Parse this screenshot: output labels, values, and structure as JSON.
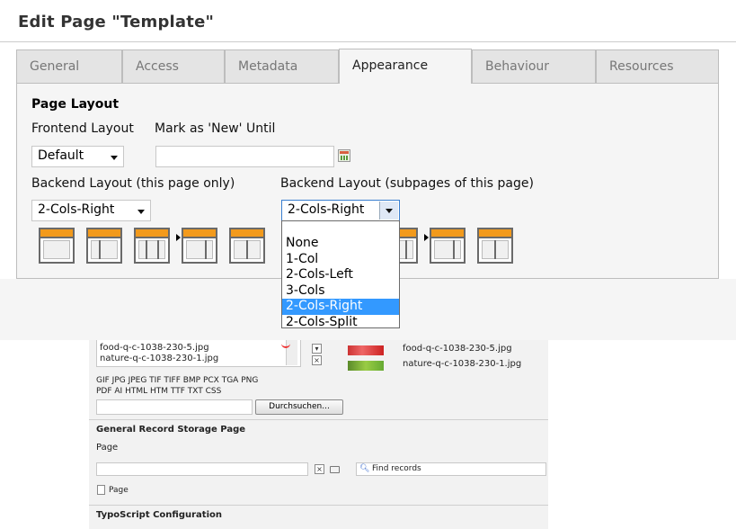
{
  "page": {
    "title": "Edit Page \"Template\""
  },
  "tabs": [
    {
      "label": "General"
    },
    {
      "label": "Access"
    },
    {
      "label": "Metadata"
    },
    {
      "label": "Appearance"
    },
    {
      "label": "Behaviour"
    },
    {
      "label": "Resources"
    }
  ],
  "active_tab": "Appearance",
  "page_layout": {
    "section_title": "Page Layout",
    "frontend_layout_label": "Frontend Layout",
    "mark_new_label": "Mark as 'New' Until",
    "frontend_layout_value": "Default",
    "mark_new_value": "",
    "backend_layout_label": "Backend Layout (this page only)",
    "backend_layout_value": "2-Cols-Right",
    "backend_sub_label": "Backend Layout (subpages of this page)",
    "backend_sub_value": "2-Cols-Right",
    "dropdown_options": [
      "None",
      "1-Col",
      "2-Cols-Left",
      "3-Cols",
      "2-Cols-Right",
      "2-Cols-Split"
    ],
    "dropdown_selected": "2-Cols-Right"
  },
  "files": {
    "list": [
      "food-q-c-1038-230-5.jpg",
      "nature-q-c-1038-230-1.jpg"
    ],
    "thumbs": [
      "food-q-c-1038-230-5.jpg",
      "nature-q-c-1038-230-1.jpg"
    ],
    "allowed_types_1": "GIF JPG JPEG TIF TIFF BMP PCX TGA PNG",
    "allowed_types_2": "PDF AI HTML HTM TTF TXT CSS",
    "browse_label": "Durchsuchen..."
  },
  "storage": {
    "section_title": "General Record Storage Page",
    "page_label": "Page",
    "find_placeholder": "Find records",
    "page_link": "Page"
  },
  "typoscript": {
    "section_title": "TypoScript Configuration"
  },
  "colors": {
    "accent": "#f29a1c",
    "selection": "#3399ff"
  }
}
